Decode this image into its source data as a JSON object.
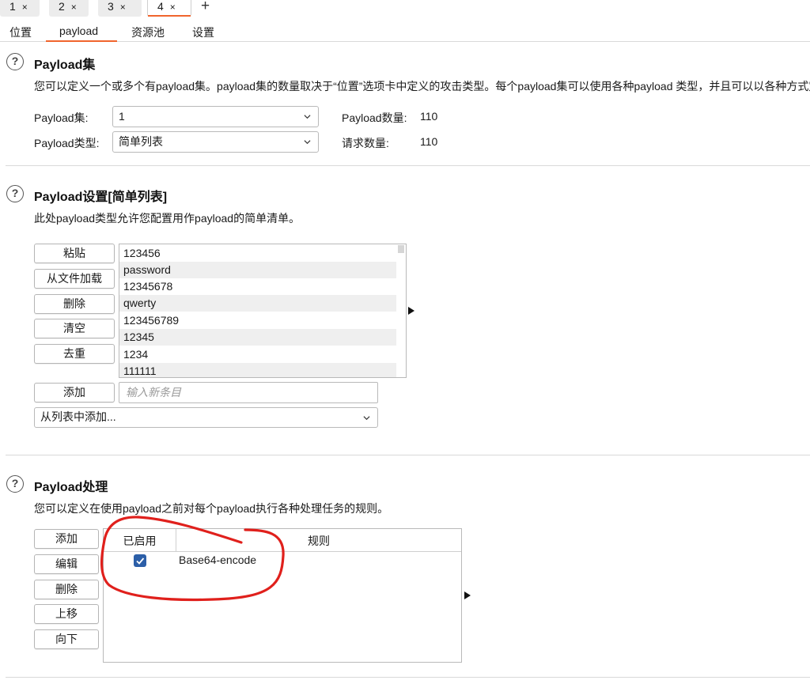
{
  "top_tabs": [
    {
      "label": "1",
      "close": "×"
    },
    {
      "label": "2",
      "close": "×"
    },
    {
      "label": "3",
      "close": "×"
    },
    {
      "label": "4",
      "close": "×"
    }
  ],
  "new_tab": "+",
  "sub_tabs": [
    "位置",
    "payload",
    "资源池",
    "设置"
  ],
  "payload_sets": {
    "title": "Payload集",
    "description": "您可以定义一个或多个有payload集。payload集的数量取决于“位置”选项卡中定义的攻击类型。每个payload集可以使用各种payload 类型，并且可以以各种方式定",
    "set_label": "Payload集:",
    "set_value": "1",
    "type_label": "Payload类型:",
    "type_value": "简单列表",
    "count_label": "Payload数量:",
    "count_value": "110",
    "request_label": "请求数量:",
    "request_value": "110"
  },
  "payload_settings": {
    "title": "Payload设置[简单列表]",
    "description": "此处payload类型允许您配置用作payload的简单清单。",
    "buttons": [
      "粘贴",
      "从文件加载",
      "删除",
      "清空",
      "去重"
    ],
    "items": [
      "123456",
      "password",
      "12345678",
      "qwerty",
      "123456789",
      "12345",
      "1234",
      "111111"
    ],
    "add_button": "添加",
    "add_placeholder": "输入新条目",
    "add_from_list": "从列表中添加..."
  },
  "payload_processing": {
    "title": "Payload处理",
    "description": "您可以定义在使用payload之前对每个payload执行各种处理任务的规则。",
    "buttons": [
      "添加",
      "编辑",
      "删除",
      "上移",
      "向下"
    ],
    "col_enabled": "已启用",
    "col_rule": "规则",
    "rows": [
      {
        "enabled": true,
        "rule": "Base64-encode"
      }
    ]
  },
  "colors": {
    "accent": "#f0652d",
    "checkbox": "#2c5fa8",
    "annotation": "#e0201c"
  }
}
